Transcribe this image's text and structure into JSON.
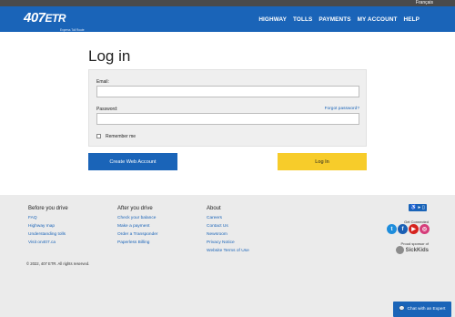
{
  "topbar": {
    "language": "Français"
  },
  "header": {
    "logo_number": "407",
    "logo_etr": "ETR",
    "logo_tagline": "Express Toll Route",
    "nav": [
      "HIGHWAY",
      "TOLLS",
      "PAYMENTS",
      "MY ACCOUNT",
      "HELP"
    ]
  },
  "page": {
    "title": "Log in"
  },
  "form": {
    "email_label": "Email:",
    "email_value": "",
    "password_label": "Password:",
    "password_value": "",
    "forgot_link": "Forgot password?",
    "remember_label": "Remember me",
    "remember_checked": false
  },
  "buttons": {
    "create": "Create Web Account",
    "login": "Log In"
  },
  "footer": {
    "columns": [
      {
        "heading": "Before you drive",
        "links": [
          "FAQ",
          "Highway map",
          "Understanding tolls",
          "Visit on407.ca"
        ]
      },
      {
        "heading": "After you drive",
        "links": [
          "Check your balance",
          "Make a payment",
          "Order a Transponder",
          "Paperless Billing"
        ]
      },
      {
        "heading": "About",
        "links": [
          "Careers",
          "Contact Us",
          "Newsroom",
          "Privacy Notice",
          "Website Terms of Use"
        ]
      }
    ],
    "copyright": "© 2022, 407 ETR. All rights reserved.",
    "get_connected": "Get Connected",
    "proud_sponsor": "Proud sponsor of",
    "sponsor_name": "SickKids"
  },
  "chat": {
    "label": "Chat with an Expert"
  },
  "colors": {
    "brand_blue": "#1a64b8",
    "login_yellow": "#f7cc2a",
    "topbar": "#4a4a4a",
    "footer_bg": "#ebebeb"
  }
}
